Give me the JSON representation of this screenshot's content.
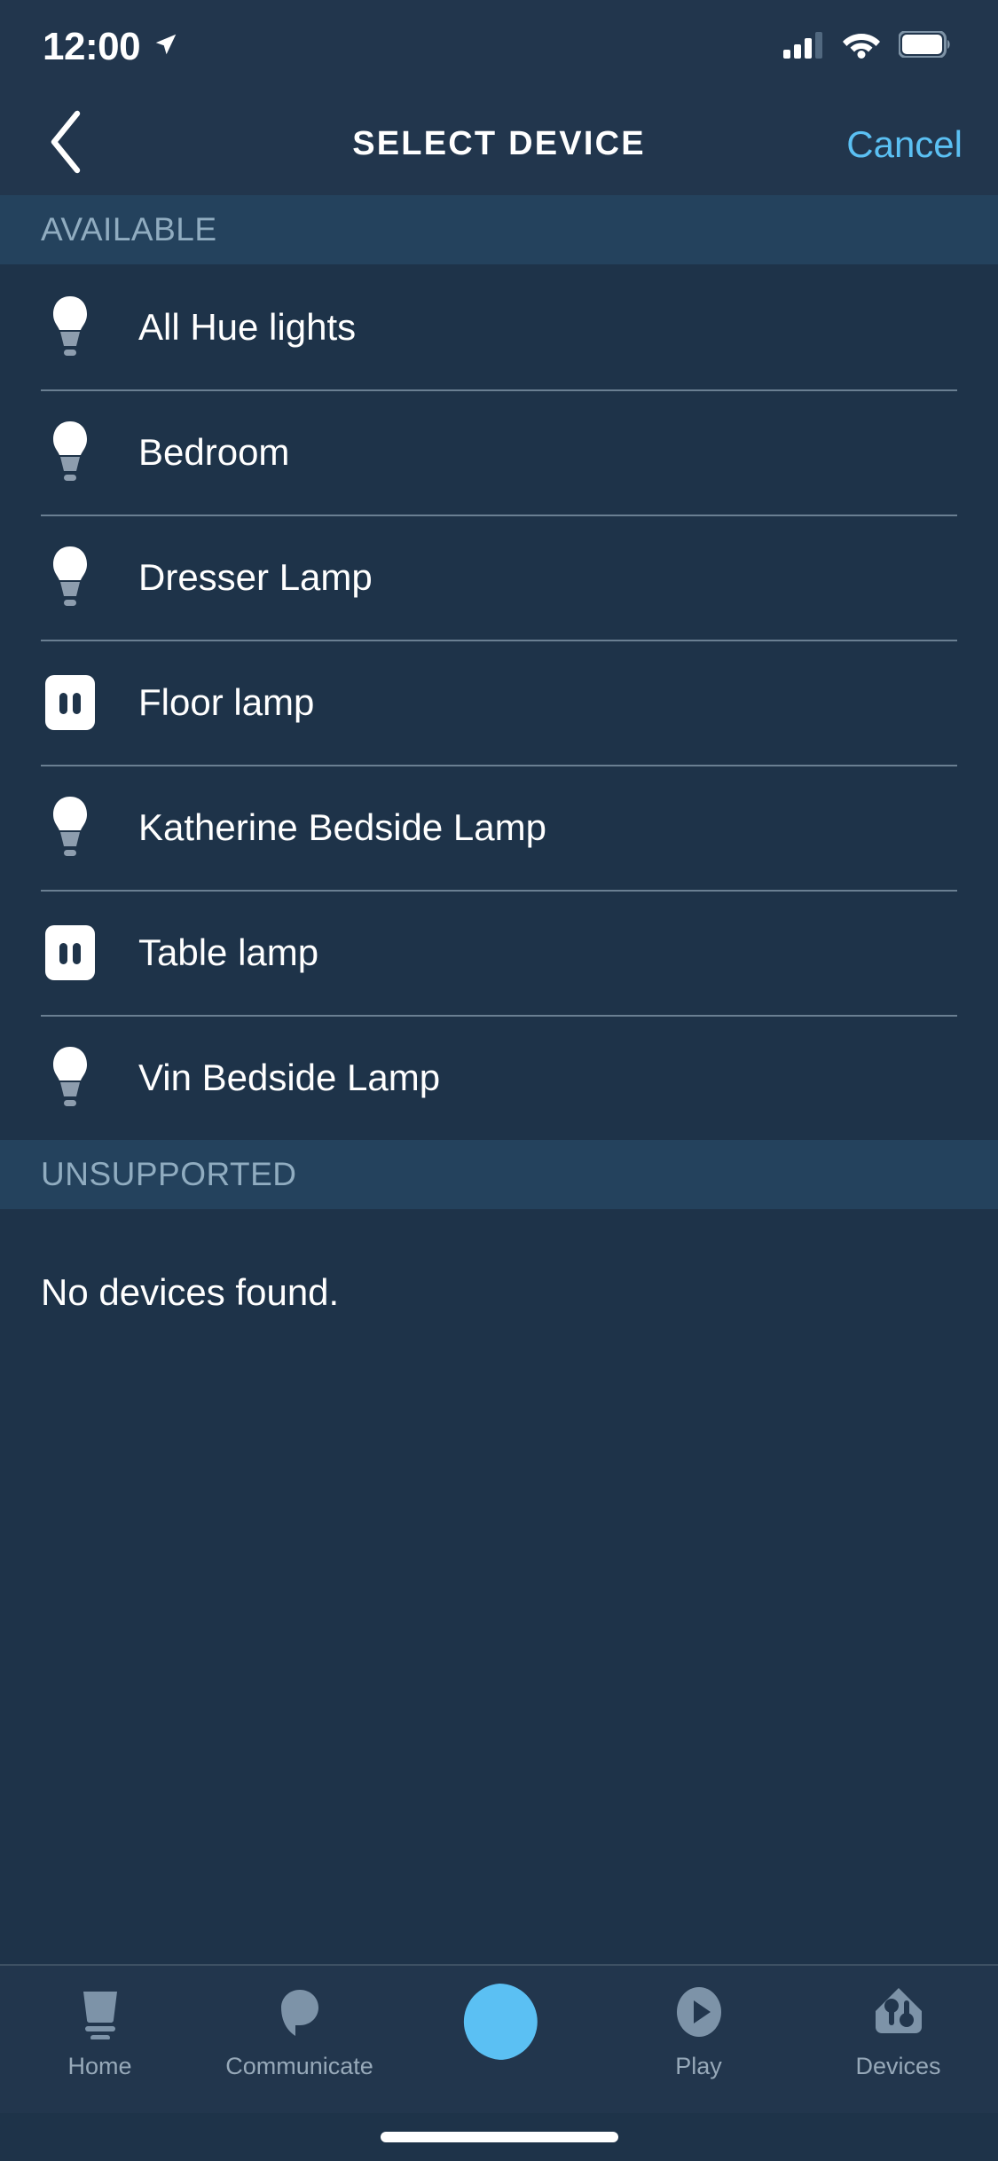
{
  "status_bar": {
    "time": "12:00",
    "location_icon": "location-arrow-icon",
    "cellular_icon": "cellular-signal-icon",
    "cellular_bars_filled": 3,
    "cellular_bars_total": 4,
    "wifi_icon": "wifi-icon",
    "battery_icon": "battery-full-icon"
  },
  "header": {
    "back_icon": "chevron-left-icon",
    "title": "SELECT DEVICE",
    "cancel_label": "Cancel"
  },
  "sections": [
    {
      "label": "AVAILABLE",
      "devices": [
        {
          "name": "All Hue lights",
          "icon": "light-bulb-icon"
        },
        {
          "name": "Bedroom",
          "icon": "light-bulb-icon"
        },
        {
          "name": "Dresser Lamp",
          "icon": "light-bulb-icon"
        },
        {
          "name": "Floor lamp",
          "icon": "smart-plug-icon"
        },
        {
          "name": "Katherine Bedside Lamp",
          "icon": "light-bulb-icon"
        },
        {
          "name": "Table lamp",
          "icon": "smart-plug-icon"
        },
        {
          "name": "Vin Bedside Lamp",
          "icon": "light-bulb-icon"
        }
      ]
    },
    {
      "label": "UNSUPPORTED",
      "empty_text": "No devices found."
    }
  ],
  "tab_bar": {
    "tabs": [
      {
        "label": "Home",
        "icon": "echo-device-icon",
        "active": false
      },
      {
        "label": "Communicate",
        "icon": "speech-bubble-icon",
        "active": false
      },
      {
        "label": "",
        "icon": "alexa-ring-icon",
        "active": true
      },
      {
        "label": "Play",
        "icon": "play-circle-icon",
        "active": false
      },
      {
        "label": "Devices",
        "icon": "home-devices-icon",
        "active": false
      }
    ]
  },
  "colors": {
    "app_background": "#1e3349",
    "chrome_background": "#22364d",
    "section_band": "#24425d",
    "accent_blue": "#5bc0f3",
    "alexa_blue": "#5bc0f3",
    "muted_text": "#90acc0",
    "tab_icon": "#7d93a8",
    "divider": "#6a7f92",
    "primary_text": "#ffffff"
  }
}
